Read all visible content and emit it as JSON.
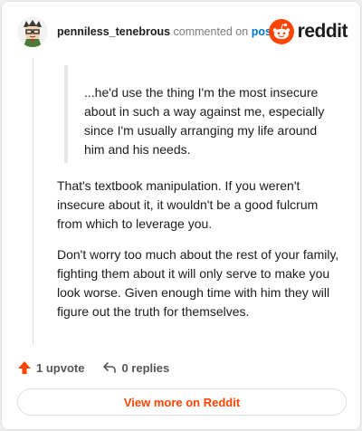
{
  "comment": {
    "username": "penniless_tenebrous",
    "verb": "commented on",
    "post_link": "post",
    "quote": "...he'd use the thing I'm the most insecure about in such a way against me, especially since I'm usually arranging my life around him and his needs.",
    "paragraphs": [
      "That's textbook manipulation. If you weren't insecure about it, it wouldn't be a good fulcrum from which to leverage you.",
      "Don't worry too much about the rest of your family, fighting them about it will only serve to make you look worse. Given enough time with him they will figure out the truth for themselves."
    ]
  },
  "brand": {
    "wordmark": "reddit",
    "color": "#ff4500"
  },
  "actions": {
    "upvote_label": "1 upvote",
    "replies_label": "0 replies"
  },
  "footer": {
    "view_more_label": "View more on Reddit"
  },
  "colors": {
    "accent": "#ff4500",
    "link": "#0079d3",
    "quote_bar": "#e6e6e6"
  },
  "icons": {
    "upvote": "arrow-up-icon",
    "reply": "reply-arrow-icon",
    "brand": "reddit-snoo-icon",
    "avatar": "user-avatar"
  }
}
